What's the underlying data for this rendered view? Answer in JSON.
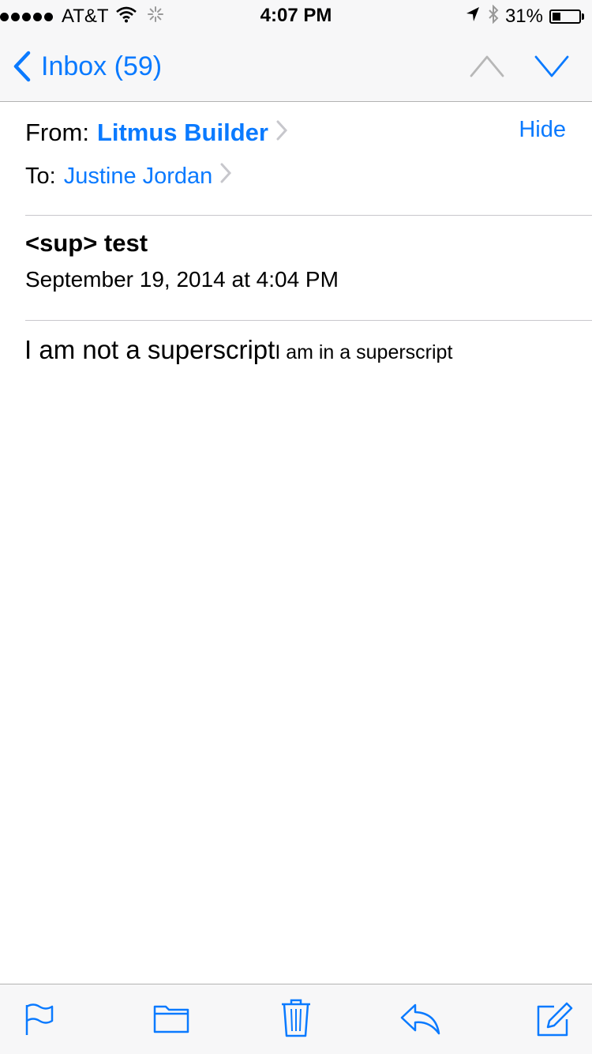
{
  "status_bar": {
    "carrier": "AT&T",
    "time": "4:07 PM",
    "battery_percent": "31%",
    "battery_level": 0.31,
    "signal_bars": 5
  },
  "nav": {
    "back_label": "Inbox (59)"
  },
  "message": {
    "from_label": "From:",
    "sender": "Litmus Builder",
    "hide_label": "Hide",
    "to_label": "To:",
    "recipient": "Justine Jordan",
    "subject": "<sup> test",
    "date": "September 19, 2014 at 4:04 PM",
    "body_text": "I am not a superscript",
    "body_sup_text": "I am in a superscript"
  },
  "toolbar": {
    "icons": [
      "flag-icon",
      "folder-icon",
      "trash-icon",
      "reply-icon",
      "compose-icon"
    ]
  },
  "colors": {
    "accent": "#0a7aff",
    "chrome_bg": "#f7f7f8",
    "divider": "#c8c7cc"
  }
}
